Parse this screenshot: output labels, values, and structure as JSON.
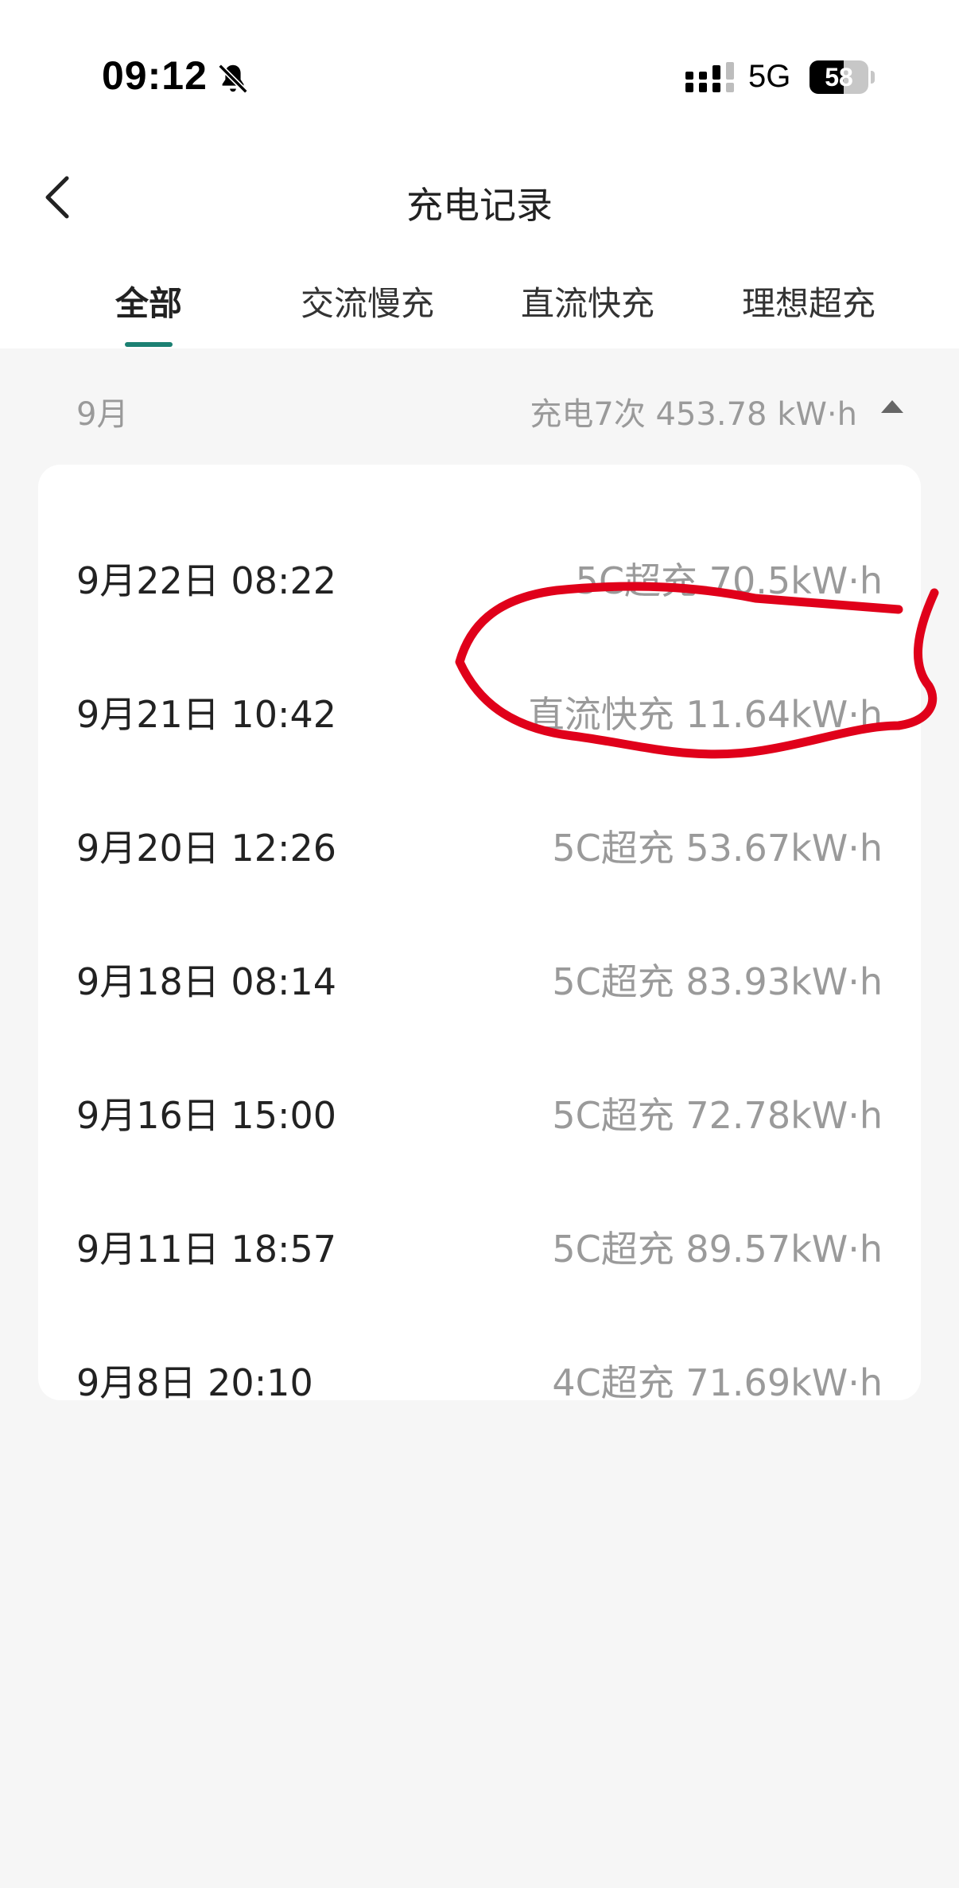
{
  "status_bar": {
    "time": "09:12",
    "network": "5G",
    "battery_level": 58,
    "battery_text": "58",
    "icons": [
      "bell-muted-icon",
      "signal-icon",
      "battery-icon"
    ]
  },
  "nav": {
    "back_icon": "chevron-left-icon",
    "title": "充电记录"
  },
  "tabs": [
    {
      "label": "全部",
      "active": true
    },
    {
      "label": "交流慢充",
      "active": false
    },
    {
      "label": "直流快充",
      "active": false
    },
    {
      "label": "理想超充",
      "active": false
    }
  ],
  "month_section": {
    "month": "9月",
    "summary": "充电7次 453.78 kW·h",
    "toggle_icon": "caret-up-icon"
  },
  "records": [
    {
      "date": "9月22日 08:22",
      "value": "5C超充 70.5kW·h"
    },
    {
      "date": "9月21日 10:42",
      "value": "直流快充 11.64kW·h"
    },
    {
      "date": "9月20日 12:26",
      "value": "5C超充 53.67kW·h"
    },
    {
      "date": "9月18日 08:14",
      "value": "5C超充 83.93kW·h"
    },
    {
      "date": "9月16日 15:00",
      "value": "5C超充 72.78kW·h"
    },
    {
      "date": "9月11日 18:57",
      "value": "5C超充 89.57kW·h"
    },
    {
      "date": "9月8日 20:10",
      "value": "4C超充 71.69kW·h"
    }
  ],
  "colors": {
    "accent": "#1b8072",
    "muted_text": "#9a9a9a",
    "annotation": "#e0001a"
  }
}
